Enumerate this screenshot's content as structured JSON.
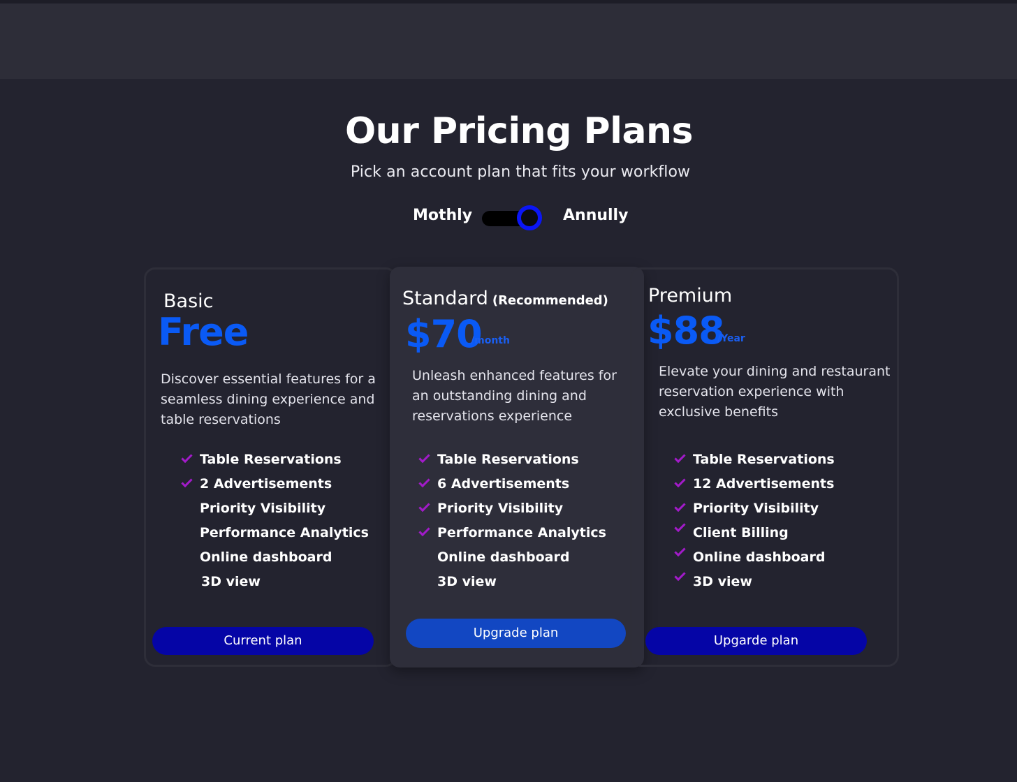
{
  "header": {
    "title": "Our Pricing Plans",
    "subtitle": "Pick an account plan that fits your workflow"
  },
  "billing_toggle": {
    "left_label": "Mothly",
    "right_label": "Annully",
    "selected": "Annully"
  },
  "colors": {
    "background": "#23232f",
    "accent_price": "#0a5af5",
    "check": "#a21bc9",
    "button_dark": "#0505a6",
    "button_blue": "#1247c2",
    "toggle_knob_ring": "#0b16f5"
  },
  "plans": [
    {
      "name": "Basic",
      "price": "Free",
      "period": "",
      "description": "Discover essential features for a seamless dining experience and table reservations",
      "features": [
        {
          "label": "Table Reservations",
          "included": true
        },
        {
          "label": "2 Advertisements",
          "included": true
        },
        {
          "label": "Priority Visibility",
          "included": false
        },
        {
          "label": "Performance Analytics",
          "included": false
        },
        {
          "label": "Online dashboard",
          "included": false
        },
        {
          "label": "3D view",
          "included": false
        }
      ],
      "button": "Current plan"
    },
    {
      "name": "Standard",
      "badge": "(Recommended)",
      "price": "$70",
      "period": "/month",
      "description": "Unleash enhanced features for an outstanding dining and reservations experience",
      "features": [
        {
          "label": "Table Reservations",
          "included": true
        },
        {
          "label": "6 Advertisements",
          "included": true
        },
        {
          "label": "Priority Visibility",
          "included": true
        },
        {
          "label": "Performance Analytics",
          "included": true
        },
        {
          "label": "Online dashboard",
          "included": false
        },
        {
          "label": "3D view",
          "included": false
        }
      ],
      "button": "Upgrade plan"
    },
    {
      "name": "Premium",
      "price": "$88",
      "period": "/Year",
      "description": "Elevate your dining and restaurant reservation experience with exclusive benefits",
      "features": [
        {
          "label": "Table Reservations",
          "included": true
        },
        {
          "label": "12 Advertisements",
          "included": true
        },
        {
          "label": "Priority Visibility",
          "included": true
        },
        {
          "label": "Client Billing",
          "included": true
        },
        {
          "label": "Online dashboard",
          "included": true
        },
        {
          "label": "3D view",
          "included": true
        }
      ],
      "button": "Upgarde plan"
    }
  ]
}
